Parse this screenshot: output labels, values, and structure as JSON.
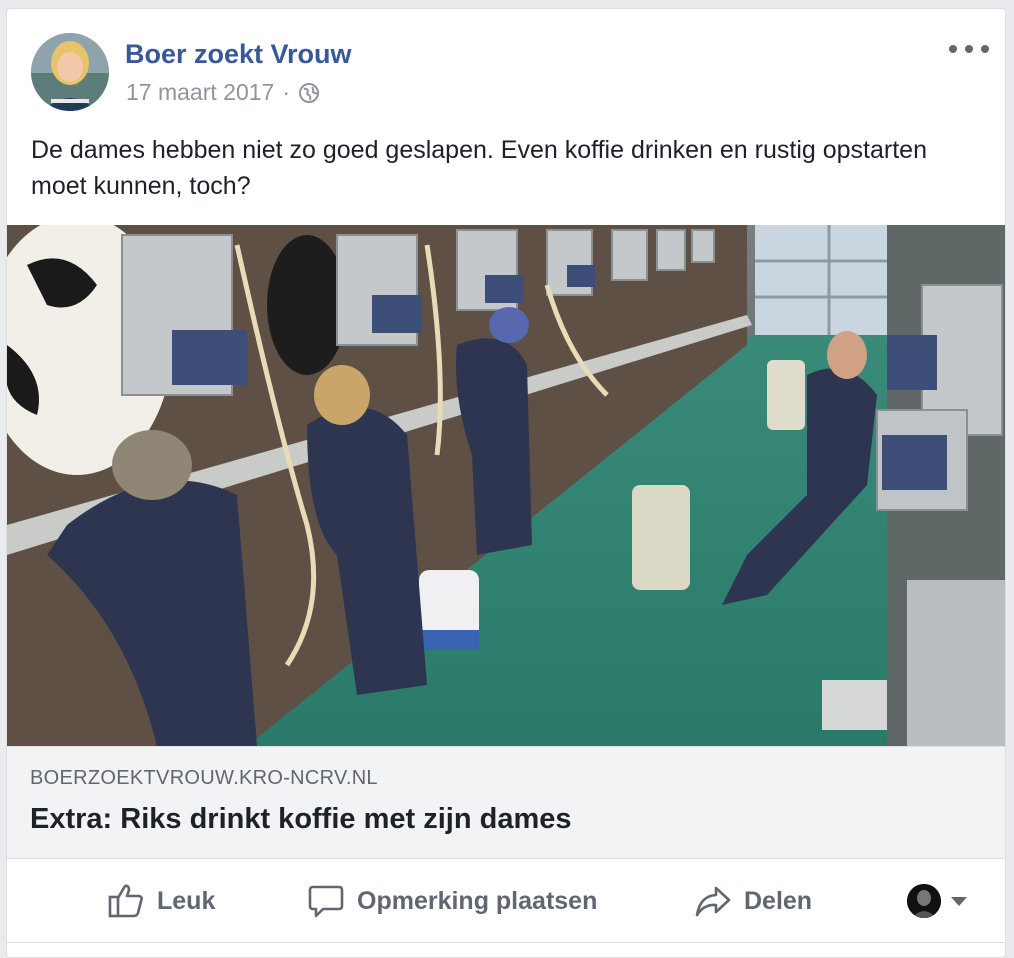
{
  "post": {
    "page_name": "Boer zoekt Vrouw",
    "date": "17 maart 2017",
    "separator": "·",
    "privacy_icon": "globe-icon",
    "more_icon": "more-options-icon",
    "text": "De dames hebben niet zo goed geslapen. Even koffie drinken en rustig opstarten moet kunnen, toch?"
  },
  "link": {
    "domain": "BOERZOEKTVROUW.KRO-NCRV.NL",
    "title": "Extra: Riks drinkt koffie met zijn dames"
  },
  "actions": {
    "like_label": "Leuk",
    "comment_label": "Opmerking plaatsen",
    "share_label": "Delen"
  },
  "colors": {
    "brand_link": "#385898",
    "action_gray": "#606770",
    "floor_green": "#2f8f7c"
  }
}
